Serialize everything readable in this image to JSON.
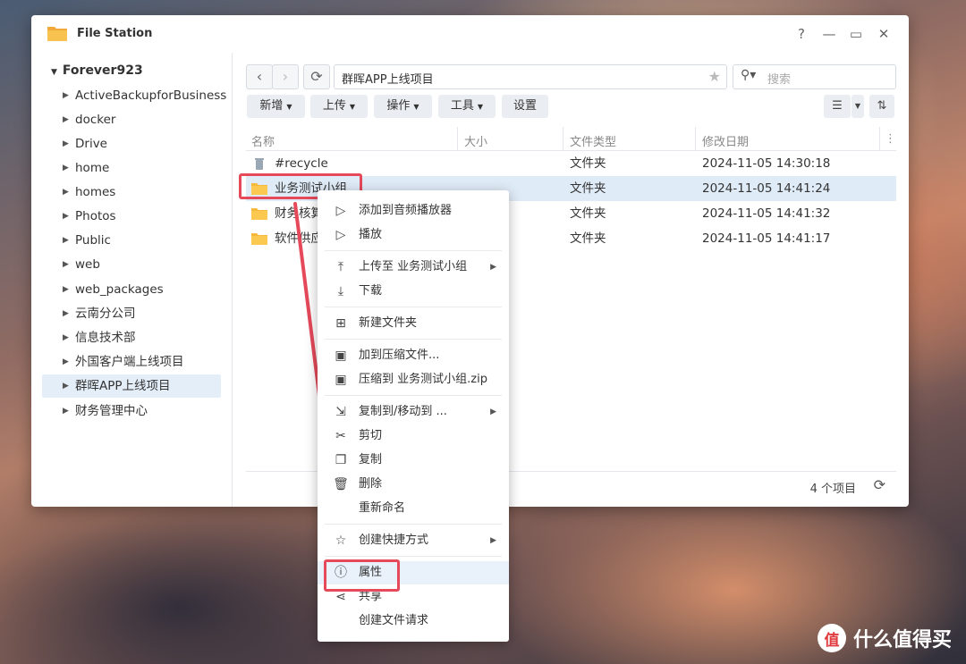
{
  "window": {
    "title": "File Station",
    "controls": {
      "help": "?",
      "minimize": "—",
      "maximize": "▭",
      "close": "✕"
    }
  },
  "sidebar": {
    "root": "Forever923",
    "items": [
      {
        "label": "ActiveBackupforBusiness"
      },
      {
        "label": "docker"
      },
      {
        "label": "Drive"
      },
      {
        "label": "home"
      },
      {
        "label": "homes"
      },
      {
        "label": "Photos"
      },
      {
        "label": "Public"
      },
      {
        "label": "web"
      },
      {
        "label": "web_packages"
      },
      {
        "label": "云南分公司"
      },
      {
        "label": "信息技术部"
      },
      {
        "label": "外国客户端上线项目"
      },
      {
        "label": "群晖APP上线项目",
        "active": true
      },
      {
        "label": "财务管理中心"
      }
    ]
  },
  "path": {
    "value": "群晖APP上线项目"
  },
  "search": {
    "placeholder": "搜索"
  },
  "toolbar": {
    "create": "新增",
    "upload": "上传",
    "action": "操作",
    "tools": "工具",
    "settings": "设置"
  },
  "columns": {
    "name": "名称",
    "size": "大小",
    "type": "文件类型",
    "modified": "修改日期"
  },
  "files": [
    {
      "name": "#recycle",
      "type": "文件夹",
      "modified": "2024-11-05 14:30:18",
      "icon": "recycle-bin-icon"
    },
    {
      "name": "业务测试小组",
      "type": "文件夹",
      "modified": "2024-11-05 14:41:24",
      "icon": "folder-icon",
      "selected": true
    },
    {
      "name": "财务核算",
      "type": "文件夹",
      "modified": "2024-11-05 14:41:32",
      "icon": "folder-icon"
    },
    {
      "name": "软件供应",
      "type": "文件夹",
      "modified": "2024-11-05 14:41:17",
      "icon": "folder-icon"
    }
  ],
  "footer": {
    "count": "4 个项目"
  },
  "context_menu": {
    "items": [
      {
        "label": "添加到音频播放器",
        "icon": "play-outline-icon"
      },
      {
        "label": "播放",
        "icon": "play-outline-icon"
      },
      {
        "label": "上传至 业务测试小组",
        "icon": "upload-icon",
        "submenu": true
      },
      {
        "label": "下载",
        "icon": "download-icon"
      },
      {
        "label": "新建文件夹",
        "icon": "new-folder-icon"
      },
      {
        "label": "加到压缩文件...",
        "icon": "archive-icon"
      },
      {
        "label": "压缩到 业务测试小组.zip",
        "icon": "archive-icon"
      },
      {
        "label": "复制到/移动到 ...",
        "icon": "copy-move-icon",
        "submenu": true
      },
      {
        "label": "剪切",
        "icon": "scissors-icon"
      },
      {
        "label": "复制",
        "icon": "copy-icon"
      },
      {
        "label": "删除",
        "icon": "trash-icon"
      },
      {
        "label": "重新命名",
        "icon": ""
      },
      {
        "label": "创建快捷方式",
        "icon": "star-icon",
        "submenu": true
      },
      {
        "label": "属性",
        "icon": "info-icon",
        "highlighted": true
      },
      {
        "label": "共享",
        "icon": "share-icon"
      },
      {
        "label": "创建文件请求",
        "icon": ""
      }
    ]
  },
  "watermark": {
    "badge": "值",
    "text": "什么值得买"
  },
  "colors": {
    "accent": "#e5495a",
    "selection": "#dfebf7",
    "folder": "#f6b93b"
  }
}
